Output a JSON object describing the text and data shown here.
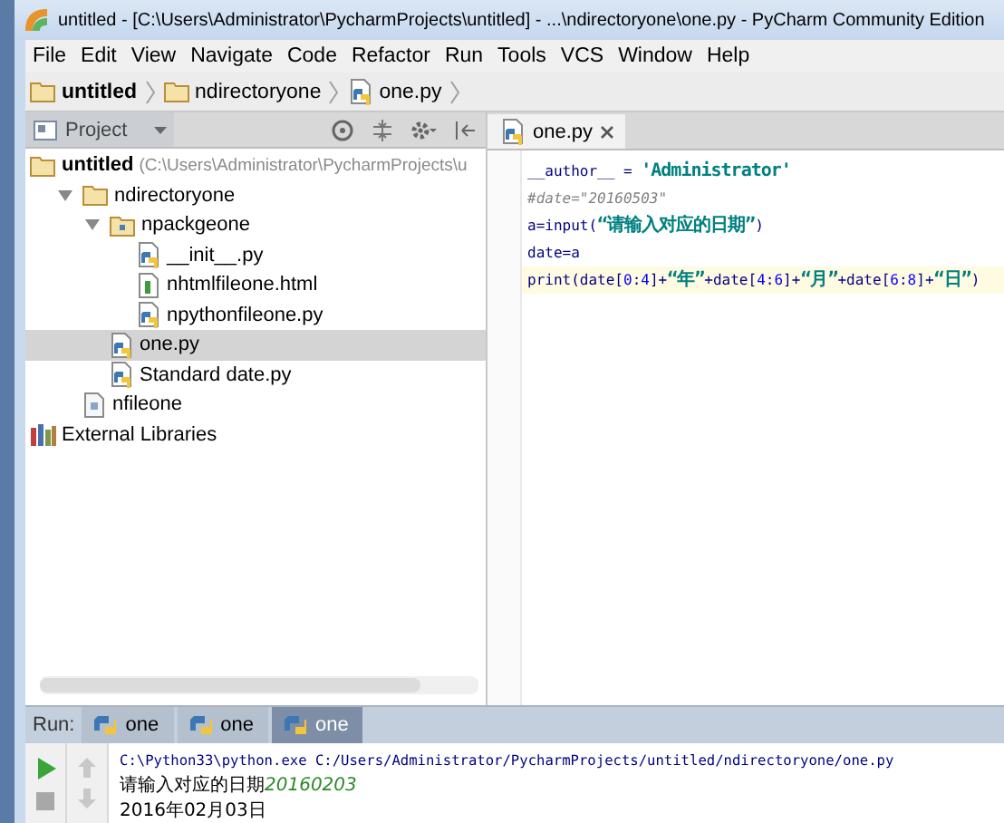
{
  "window": {
    "title": "untitled - [C:\\Users\\Administrator\\PycharmProjects\\untitled] - ...\\ndirectoryone\\one.py - PyCharm Community Edition"
  },
  "menu": [
    "File",
    "Edit",
    "View",
    "Navigate",
    "Code",
    "Refactor",
    "Run",
    "Tools",
    "VCS",
    "Window",
    "Help"
  ],
  "breadcrumbs": [
    {
      "label": "untitled",
      "kind": "folder",
      "bold": true
    },
    {
      "label": "ndirectoryone",
      "kind": "folder",
      "bold": false
    },
    {
      "label": "one.py",
      "kind": "python",
      "bold": false
    }
  ],
  "project_panel": {
    "title": "Project",
    "tree": [
      {
        "label": "untitled",
        "kind": "project",
        "hint": "(C:\\Users\\Administrator\\PycharmProjects\\u",
        "selected": false,
        "children": [
          {
            "label": "ndirectoryone",
            "kind": "folder",
            "expanded": true,
            "selected": false,
            "children": [
              {
                "label": "npackgeone",
                "kind": "package",
                "expanded": true,
                "selected": false,
                "children": [
                  {
                    "label": "__init__.py",
                    "kind": "python",
                    "selected": false
                  },
                  {
                    "label": "nhtmlfileone.html",
                    "kind": "html",
                    "selected": false
                  },
                  {
                    "label": "npythonfileone.py",
                    "kind": "python",
                    "selected": false
                  }
                ]
              },
              {
                "label": "one.py",
                "kind": "python",
                "selected": true
              },
              {
                "label": "Standard date.py",
                "kind": "python",
                "selected": false
              }
            ]
          },
          {
            "label": "nfileone",
            "kind": "text",
            "selected": false
          }
        ]
      },
      {
        "label": "External Libraries",
        "kind": "libraries",
        "selected": false
      }
    ]
  },
  "editor": {
    "tabs": [
      {
        "label": "one.py",
        "selected": true
      }
    ],
    "lines": [
      {
        "current": false,
        "tokens": [
          {
            "text": "__author__ = ",
            "kind": "plain"
          },
          {
            "text": "'Administrator'",
            "kind": "string"
          }
        ]
      },
      {
        "current": false,
        "tokens": [
          {
            "text": "#date=\"20160503\"",
            "kind": "comment"
          }
        ]
      },
      {
        "current": false,
        "tokens": [
          {
            "text": "a=input(",
            "kind": "plain"
          },
          {
            "text": "“请输入对应的日期”",
            "kind": "string"
          },
          {
            "text": ")",
            "kind": "plain"
          }
        ]
      },
      {
        "current": false,
        "tokens": [
          {
            "text": "date=a",
            "kind": "plain"
          }
        ]
      },
      {
        "current": true,
        "tokens": [
          {
            "text": "print(date[",
            "kind": "plain"
          },
          {
            "text": "0",
            "kind": "number"
          },
          {
            "text": ":",
            "kind": "plain"
          },
          {
            "text": "4",
            "kind": "number"
          },
          {
            "text": "]+",
            "kind": "plain"
          },
          {
            "text": "“年”",
            "kind": "string"
          },
          {
            "text": "+date[",
            "kind": "plain"
          },
          {
            "text": "4",
            "kind": "number"
          },
          {
            "text": ":",
            "kind": "plain"
          },
          {
            "text": "6",
            "kind": "number"
          },
          {
            "text": "]+",
            "kind": "plain"
          },
          {
            "text": "“月”",
            "kind": "string"
          },
          {
            "text": "+date[",
            "kind": "plain"
          },
          {
            "text": "6",
            "kind": "number"
          },
          {
            "text": ":",
            "kind": "plain"
          },
          {
            "text": "8",
            "kind": "number"
          },
          {
            "text": "]+",
            "kind": "plain"
          },
          {
            "text": "“日”",
            "kind": "string"
          },
          {
            "text": ")",
            "kind": "plain"
          }
        ]
      }
    ]
  },
  "run": {
    "label": "Run:",
    "tabs": [
      {
        "label": "one",
        "selected": false
      },
      {
        "label": "one",
        "selected": false
      },
      {
        "label": "one",
        "selected": true
      }
    ],
    "console": [
      [
        {
          "text": "C:\\Python33\\python.exe C:/Users/Administrator/PycharmProjects/untitled/ndirectoryone/one.py",
          "kind": "command"
        }
      ],
      [
        {
          "text": "请输入对应的日期",
          "kind": "output"
        },
        {
          "text": "20160203",
          "kind": "input"
        }
      ],
      [
        {
          "text": "2016年02月03日",
          "kind": "output"
        }
      ]
    ]
  }
}
